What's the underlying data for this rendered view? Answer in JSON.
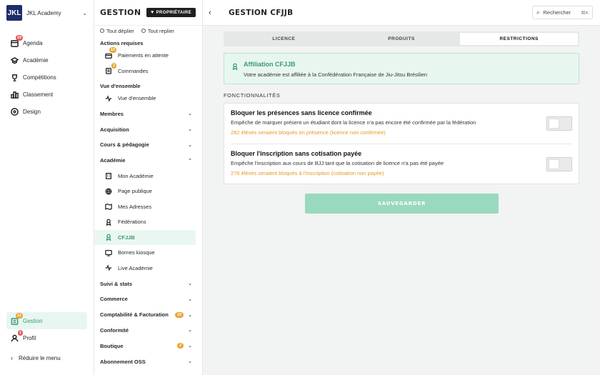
{
  "brand": {
    "logo_text": "JKL",
    "name": "JKL Academy"
  },
  "rail": {
    "items": [
      {
        "label": "Agenda",
        "badge": "19",
        "icon": "agenda-icon"
      },
      {
        "label": "Académie",
        "icon": "academy-icon"
      },
      {
        "label": "Compétitions",
        "icon": "trophy-icon"
      },
      {
        "label": "Classement",
        "icon": "ranking-icon"
      },
      {
        "label": "Design",
        "icon": "palette-icon"
      }
    ],
    "bottom": [
      {
        "label": "Gestion",
        "badge": "12",
        "icon": "management-icon"
      },
      {
        "label": "Profil",
        "badge": "1",
        "icon": "profile-icon"
      }
    ],
    "collapse_label": "Réduire le menu"
  },
  "side": {
    "title": "GESTION",
    "owner_badge": "PROPRIÉTAIRE",
    "expand_all": "Tout déplier",
    "collapse_all": "Tout replier",
    "required_actions_label": "Actions requises",
    "required_actions": [
      {
        "label": "Paiements en attente",
        "badge": "10"
      },
      {
        "label": "Commandes",
        "badge": "2"
      }
    ],
    "overview_label": "Vue d'ensemble",
    "overview_item": "Vue d'ensemble",
    "groups_top": [
      "Membres",
      "Acquisition",
      "Cours & pédagogie"
    ],
    "academy_group": "Académie",
    "academy_items": [
      "Mon Académie",
      "Page publique",
      "Mes Adresses",
      "Fédérations",
      "CFJJB",
      "Bornes kiosque",
      "Live Académie"
    ],
    "groups_bottom": [
      {
        "label": "Suivi & stats"
      },
      {
        "label": "Commerce"
      },
      {
        "label": "Comptabilité & Facturation",
        "badge": "10"
      },
      {
        "label": "Conformité"
      },
      {
        "label": "Boutique",
        "badge": "2"
      },
      {
        "label": "Abonnement OSS"
      }
    ]
  },
  "main": {
    "title": "GESTION CFJJB",
    "search_placeholder": "Rechercher",
    "search_shortcut": "⌘K",
    "tabs": [
      "LICENCE",
      "PRODUITS",
      "RESTRICTIONS"
    ],
    "selected_tab": "RESTRICTIONS",
    "info": {
      "title": "Affiliation CFJJB",
      "text": "Votre académie est affiliée à la Confédération Française de Jiu-Jitsu Brésilien"
    },
    "features_heading": "FONCTIONNALITÉS",
    "features": [
      {
        "title": "Bloquer les présences sans licence confirmée",
        "desc": "Empêche de marquer présent un étudiant dont la licence n'a pas encore été confirmée par la fédération",
        "warn": "282 élèves seraient bloqués en présence (licence non confirmée)",
        "enabled": false
      },
      {
        "title": "Bloquer l'inscription sans cotisation payée",
        "desc": "Empêche l'inscription aux cours de BJJ tant que la cotisation de licence n'a pas été payée",
        "warn": "276 élèves seraient bloqués à l'inscription (cotisation non payée)",
        "enabled": false
      }
    ],
    "save_label": "SAUVEGARDER"
  },
  "colors": {
    "accent": "#3a9a73",
    "warning": "#e39a22",
    "badge_red": "#e35b5b",
    "badge_orange": "#e8a533",
    "save_button": "#99d9bd"
  }
}
